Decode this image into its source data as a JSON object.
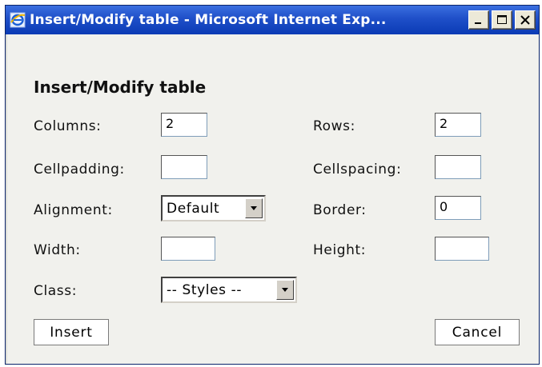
{
  "window": {
    "title": "Insert/Modify table - Microsoft Internet Exp...",
    "icon": "ie-icon",
    "controls": [
      "minimize-icon",
      "maximize-icon",
      "close-icon"
    ]
  },
  "dialog": {
    "heading": "Insert/Modify table",
    "columns": {
      "label": "Columns:",
      "value": "2"
    },
    "rows": {
      "label": "Rows:",
      "value": "2"
    },
    "cellpadding": {
      "label": "Cellpadding:",
      "value": ""
    },
    "cellspacing": {
      "label": "Cellspacing:",
      "value": ""
    },
    "alignment": {
      "label": "Alignment:",
      "value": "Default"
    },
    "border": {
      "label": "Border:",
      "value": "0"
    },
    "width": {
      "label": "Width:",
      "value": ""
    },
    "height": {
      "label": "Height:",
      "value": ""
    },
    "class": {
      "label": "Class:",
      "value": "-- Styles --"
    },
    "insert_label": "Insert",
    "cancel_label": "Cancel"
  },
  "colors": {
    "titlebar": "#1f4fc8",
    "background": "#f1f1ed"
  }
}
